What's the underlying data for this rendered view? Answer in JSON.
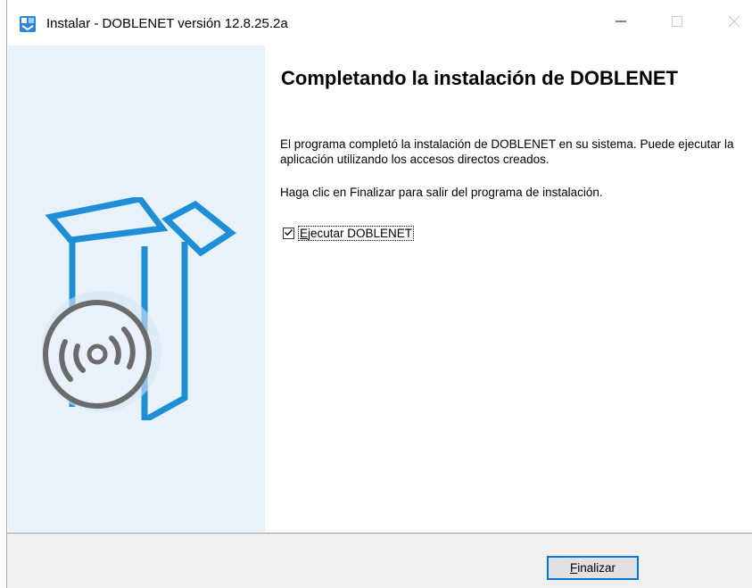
{
  "window": {
    "title": "Instalar - DOBLENET versión 12.8.25.2a",
    "icon": "installer-app-icon",
    "controls": {
      "minimize_icon": "minimize-icon",
      "maximize_icon": "maximize-icon",
      "close_icon": "close-icon"
    }
  },
  "wizard": {
    "heading": "Completando la instalación de DOBLENET",
    "paragraph1": "El programa completó la instalación de DOBLENET en su sistema. Puede ejecutar la aplicación utilizando los accesos directos creados.",
    "paragraph2": "Haga clic en Finalizar para salir del programa de instalación.",
    "run_checkbox": {
      "checked": true,
      "label_mnemonic": "E",
      "label_rest": "jecutar DOBLENET"
    },
    "side_art": "software-box-with-disc-icon"
  },
  "footer": {
    "finish_mnemonic": "F",
    "finish_rest": "inalizar"
  },
  "colors": {
    "side_panel": "#e9f2fa",
    "box_blue": "#1e8fd6",
    "disc_gray": "#6b6b6b",
    "footer_bg": "#f0f0f0",
    "focus_border": "#0078d7"
  }
}
